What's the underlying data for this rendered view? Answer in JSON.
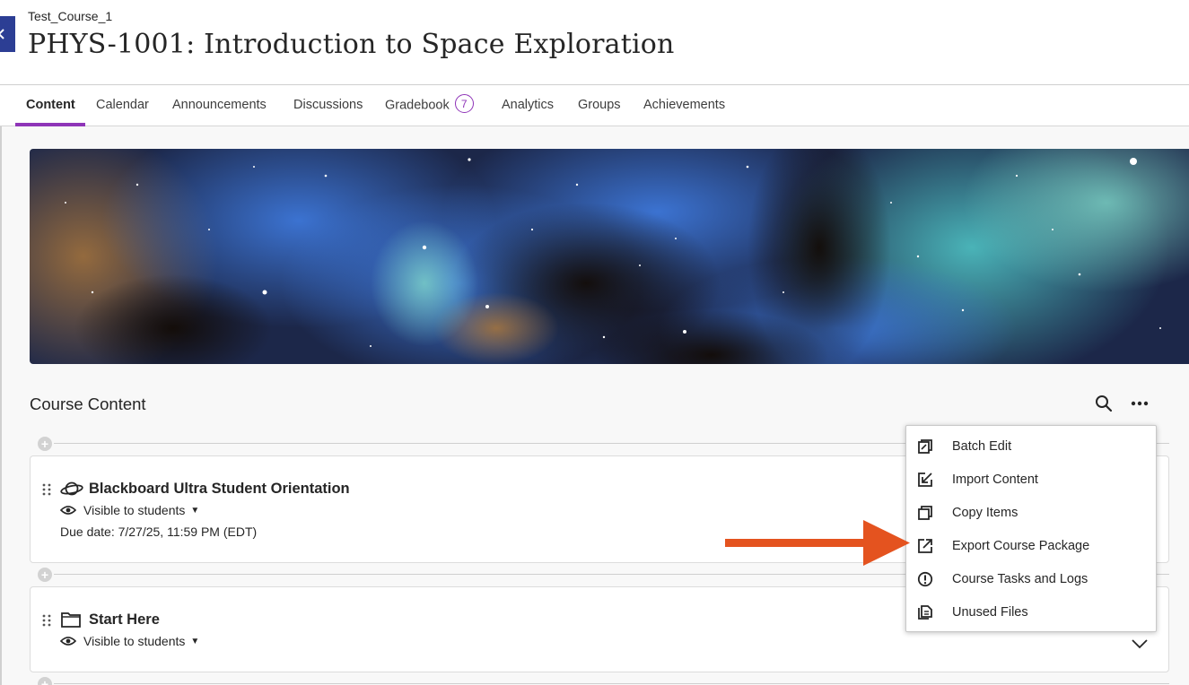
{
  "header": {
    "course_id": "Test_Course_1",
    "course_title": "PHYS-1001: Introduction to Space Exploration"
  },
  "tabs": [
    {
      "label": "Content",
      "active": true
    },
    {
      "label": "Calendar"
    },
    {
      "label": "Announcements"
    },
    {
      "label": "Discussions"
    },
    {
      "label": "Gradebook",
      "badge": "7"
    },
    {
      "label": "Analytics"
    },
    {
      "label": "Groups"
    },
    {
      "label": "Achievements"
    }
  ],
  "course_content": {
    "heading": "Course Content",
    "items": [
      {
        "title": "Blackboard Ultra Student Orientation",
        "icon": "orbit-icon",
        "visibility": "Visible to students",
        "due": "Due date: 7/27/25, 11:59 PM (EDT)"
      },
      {
        "title": "Start Here",
        "icon": "folder-icon",
        "visibility": "Visible to students"
      }
    ]
  },
  "more_menu": {
    "items": [
      {
        "label": "Batch Edit",
        "icon": "batch-edit-icon"
      },
      {
        "label": "Import Content",
        "icon": "import-icon"
      },
      {
        "label": "Copy Items",
        "icon": "copy-icon"
      },
      {
        "label": "Export Course Package",
        "icon": "export-icon"
      },
      {
        "label": "Course Tasks and Logs",
        "icon": "alert-circle-icon"
      },
      {
        "label": "Unused Files",
        "icon": "files-icon"
      }
    ]
  },
  "colors": {
    "accent": "#8f35b8",
    "annotation_arrow": "#e4531f",
    "side_tab": "#2c3e94"
  }
}
